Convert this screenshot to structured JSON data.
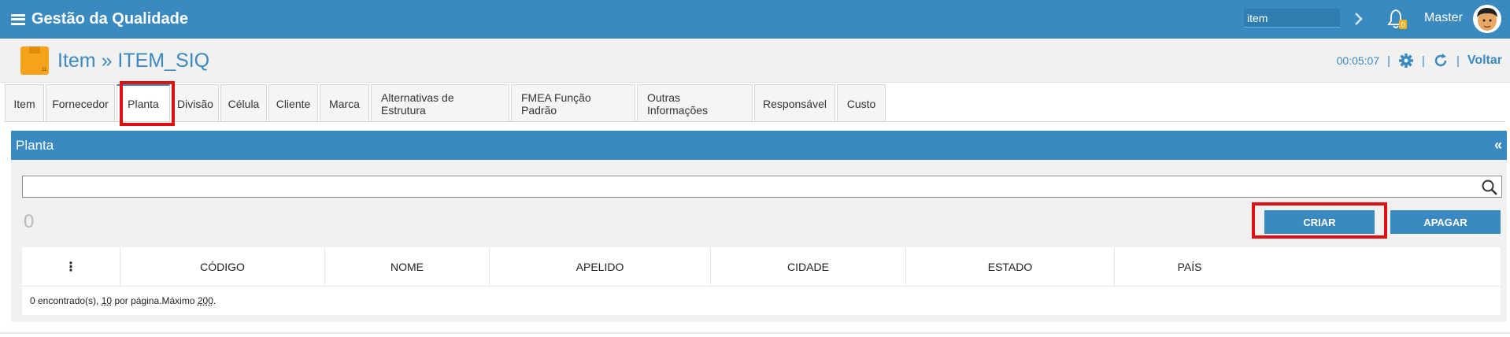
{
  "app": {
    "title": "Gestão da Qualidade"
  },
  "topbar": {
    "search_value": "item",
    "user_name": "Master",
    "bell_badge": "0"
  },
  "page": {
    "title": "Item » ITEM_SIQ",
    "timer": "00:05:07",
    "back_label": "Voltar"
  },
  "tabs": [
    {
      "label": "Item"
    },
    {
      "label": "Fornecedor"
    },
    {
      "label": "Planta"
    },
    {
      "label": "Divisão"
    },
    {
      "label": "Célula"
    },
    {
      "label": "Cliente"
    },
    {
      "label": "Marca"
    },
    {
      "label": "Alternativas de Estrutura"
    },
    {
      "label": "FMEA Função Padrão"
    },
    {
      "label": "Outras Informações"
    },
    {
      "label": "Responsável"
    },
    {
      "label": "Custo"
    }
  ],
  "panel": {
    "title": "Planta",
    "collapse_label": "«",
    "search_value": "",
    "count": "0",
    "create_label": "CRIAR",
    "delete_label": "APAGAR",
    "columns": [
      "⋮",
      "CÓDIGO",
      "NOME",
      "APELIDO",
      "CIDADE",
      "ESTADO",
      "PAÍS"
    ],
    "footer": {
      "found": "0 encontrado(s),",
      "per_page_value": "10",
      "per_page_text": "por página.",
      "max_text": "Máximo",
      "max_value": "200",
      "end": "."
    }
  },
  "colors": {
    "primary": "#3a8ac1",
    "highlight": "#e01010"
  }
}
